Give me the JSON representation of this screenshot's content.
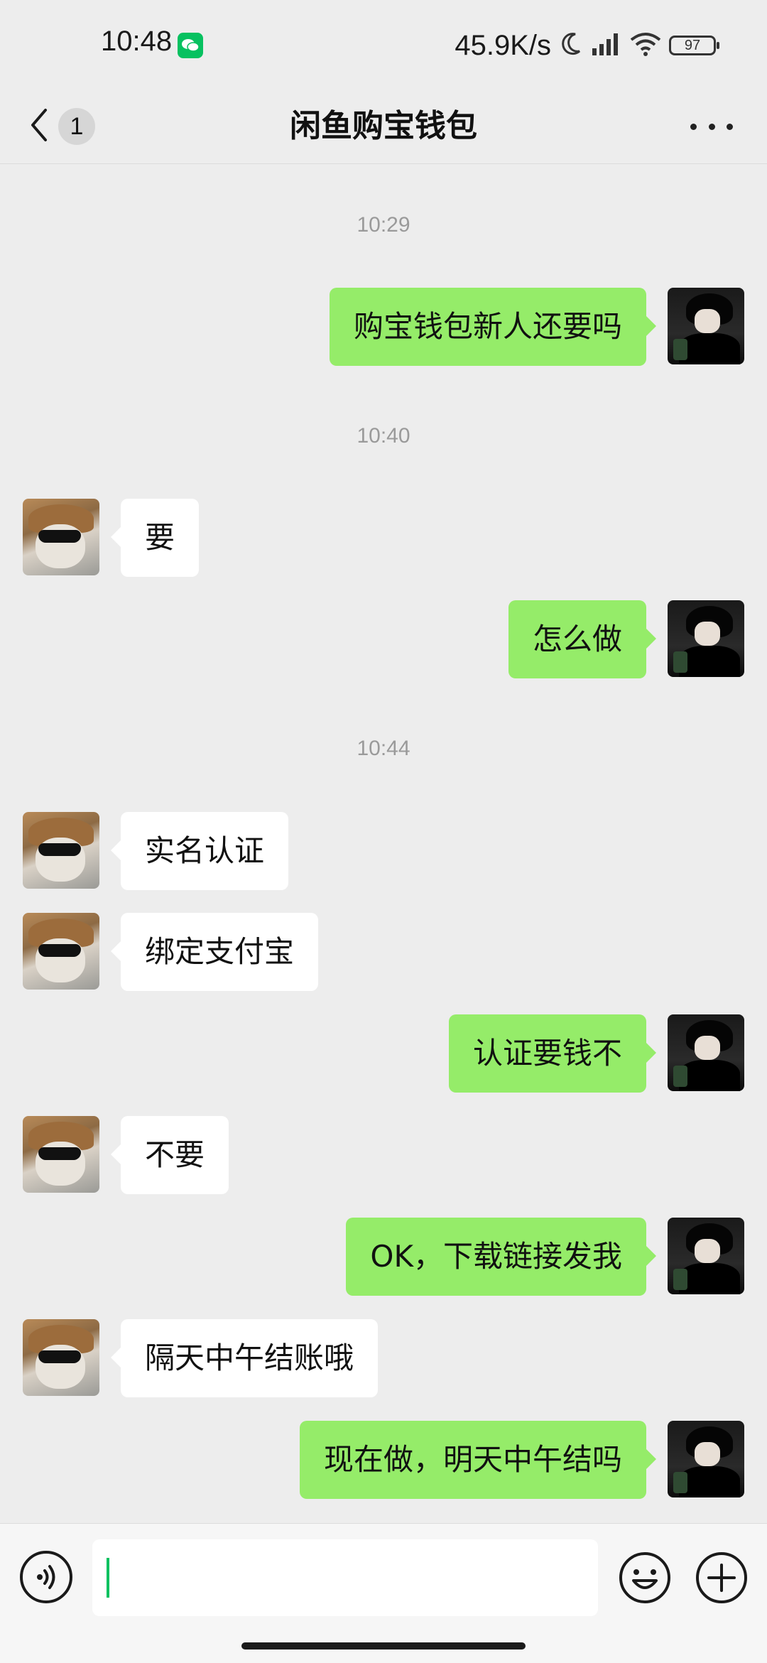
{
  "status_bar": {
    "time": "10:48",
    "net_speed": "45.9K/s",
    "battery": "97",
    "app_notification_icon": "wechat-icon"
  },
  "nav": {
    "unread_count": "1",
    "title": "闲鱼购宝钱包",
    "back_icon": "chevron-left-icon",
    "more_icon": "more-dots-icon"
  },
  "timestamps": [
    "10:29",
    "10:40",
    "10:44"
  ],
  "messages": [
    {
      "side": "right",
      "text": "购宝钱包新人还要吗"
    },
    {
      "side": "left",
      "text": "要"
    },
    {
      "side": "right",
      "text": "怎么做"
    },
    {
      "side": "left",
      "text": "实名认证"
    },
    {
      "side": "left",
      "text": "绑定支付宝"
    },
    {
      "side": "right",
      "text": "认证要钱不"
    },
    {
      "side": "left",
      "text": "不要"
    },
    {
      "side": "right",
      "text": "OK，下载链接发我"
    },
    {
      "side": "left",
      "text": "隔天中午结账哦"
    },
    {
      "side": "right",
      "text": "现在做，明天中午结吗"
    }
  ],
  "input_bar": {
    "value": "",
    "voice_icon": "voice-icon",
    "emoji_icon": "emoji-icon",
    "plus_icon": "plus-icon"
  },
  "colors": {
    "background": "#ededed",
    "sent_bubble": "#95ec69",
    "received_bubble": "#ffffff",
    "accent": "#07c160"
  }
}
